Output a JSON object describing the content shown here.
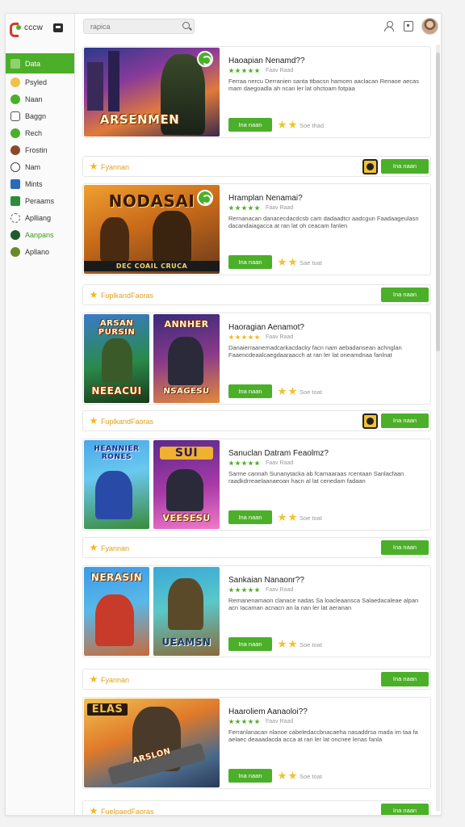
{
  "app": {
    "logo_text": "cccw"
  },
  "search": {
    "placeholder": "rapica"
  },
  "sidebar": {
    "items": [
      {
        "label": "Data",
        "icon": "grid-icon",
        "active": true
      },
      {
        "label": "Psyled",
        "icon": "smile-icon"
      },
      {
        "label": "Naan",
        "icon": "trend-icon"
      },
      {
        "label": "Baggn",
        "icon": "bag-icon"
      },
      {
        "label": "Rech",
        "icon": "chart-icon"
      },
      {
        "label": "Frostin",
        "icon": "avatar-icon"
      },
      {
        "label": "Nam",
        "icon": "globe-icon"
      },
      {
        "label": "Mints",
        "icon": "stats-icon"
      },
      {
        "label": "Peraams",
        "icon": "sprout-icon"
      },
      {
        "label": "Aplliang",
        "icon": "loader-icon"
      },
      {
        "label": "Aanpans",
        "icon": "game-icon"
      },
      {
        "label": "Apllano",
        "icon": "fox-icon"
      }
    ]
  },
  "cards": [
    {
      "title": "Haoapian Nenamd??",
      "rating_text": "Faav Raad",
      "desc": "Ferraa nercu Derranien santa ttbacsn hamcen aaclacan Renaoe aecas mam daegoadla ah ncan ler lat ohctoam fotpaa",
      "play": "Ina naan",
      "count": "Soe thad",
      "art": [
        "ARSENMEN"
      ]
    },
    {
      "title": "Hramplan Nenamai?",
      "rating_text": "Faav Raad",
      "desc": "Rernanacan danacecdacdcsb cam dadaadtcr aadcgun Faadaageulasn dacandaiagacca at ran lat oh ceacam fanlen",
      "play": "Ina naan",
      "count": "Sae toat",
      "art": [
        "NODASAI",
        "DEC COAIL CRUCA"
      ]
    },
    {
      "title": "Haoragian Aenamot?",
      "rating_text": "Faav Raad",
      "desc": "Danaierraanemadcarkacdacky facn nam aebadansean achnglan Faaencdeaalcaegdaaraacch at ran ler lat oneamdnaa fanlnat",
      "play": "Ina naan",
      "count": "Soe toat",
      "art": [
        "ARSAN PURSIN",
        "NEEACUI",
        "ANNHER",
        "NSAGESU"
      ]
    },
    {
      "title": "Sanuclan Datram Feaolmz?",
      "rating_text": "Faav Raad",
      "desc": "Sarme cannah Sunanytacka ab fcarnaaraas rcentaan Sanlacfaan raadkdrreaelaanaeoan hacn al lat cenedam fadaan",
      "play": "Ina naan",
      "count": "Soe toat",
      "art": [
        "HEANNIER RONES",
        "SUI",
        "VEESESU"
      ]
    },
    {
      "title": "Sankaian Nanaonr??",
      "rating_text": "Faav Raad",
      "desc": "Remanenamaon clanace nadas Sa loacleaansca Salaedacaleae alpan acn Iacaman acnacn an la nan ler lat aeranan",
      "play": "Ina naan",
      "count": "Soe toat",
      "art": [
        "NERASIN",
        "UEAMSN"
      ]
    },
    {
      "title": "Haaroliem Aanaoloi??",
      "rating_text": "Faav Raad",
      "desc": "Ferranlanacan nlanoe cabeledaccbnacaeha nasaddrsa mada im taa fa aelaec deaaadacda acca at ran ler lat oncnee lenas fanla",
      "play": "Ina naan",
      "count": "Soe toat",
      "art": [
        "ELAS",
        "ARSLON"
      ]
    }
  ],
  "bars": [
    {
      "label": "Fyannan",
      "button": "Ina naan",
      "has_icon": true
    },
    {
      "label": "FuplkandFaoras",
      "button": "Ina naan",
      "has_icon": false
    },
    {
      "label": "FuplkandFaoras",
      "button": "Ina naan",
      "has_icon": true
    },
    {
      "label": "Fyannan",
      "button": "Ina naan",
      "has_icon": false
    },
    {
      "label": "Fyannan",
      "button": "Ina naan",
      "has_icon": false
    },
    {
      "label": "FuelpaedFaoras",
      "button": "Ina naan",
      "has_icon": false
    }
  ],
  "colors": {
    "accent": "#4caf2a",
    "star": "#f2c230",
    "label": "#e0a020"
  }
}
